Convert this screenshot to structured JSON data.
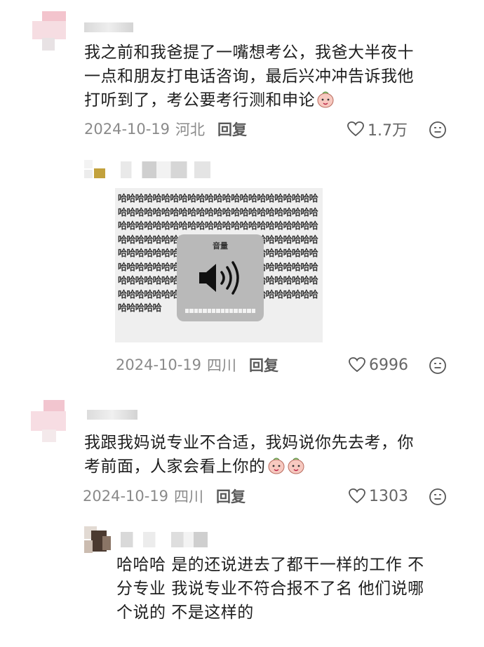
{
  "comments": [
    {
      "text": "我之前和我爸提了一嘴想考公，我爸大半夜十一点和朋友打电话咨询，最后兴冲冲告诉我他打听到了，考公要考行测和申论",
      "text_lines": [
        "我之前和我爸提了一嘴想考公，我爸大半夜十",
        "一点和朋友打电话咨询，最后兴冲冲告诉我他",
        "打听到了，考公要考行测和申论"
      ],
      "date": "2024-10-19",
      "location": "河北",
      "reply_label": "回复",
      "likes": "1.7万"
    },
    {
      "sticker": {
        "title": "音量",
        "fill_text": "哈哈哈哈哈哈哈哈哈哈哈哈哈哈哈哈哈哈哈哈哈哈哈哈哈哈哈哈哈哈哈哈哈哈哈哈哈哈哈哈哈哈哈哈哈哈哈哈哈哈哈哈哈哈哈哈哈哈哈哈哈哈哈哈哈哈哈哈哈哈哈哈哈哈哈哈哈哈哈哈哈哈哈哈哈哈哈哈哈哈哈哈哈哈哈哈哈哈哈哈哈哈哈哈哈哈哈哈哈哈哈哈哈哈哈哈哈哈哈哈哈哈哈哈哈哈哈哈哈哈哈哈哈哈哈哈哈哈哈哈哈哈哈哈哈哈哈哈哈哈哈哈哈哈哈哈哈哈哈哈哈哈哈哈哈哈哈哈哈哈哈哈哈哈哈哈哈哈哈哈哈哈哈哈哈哈哈哈哈"
      },
      "date": "2024-10-19",
      "location": "四川",
      "reply_label": "回复",
      "likes": "6996"
    },
    {
      "text": "我跟我妈说专业不合适，我妈说你先去考，你考前面，人家会看上你的",
      "text_lines": [
        "我跟我妈说专业不合适，我妈说你先去考，你",
        "考前面，人家会看上你的"
      ],
      "date": "2024-10-19",
      "location": "四川",
      "reply_label": "回复",
      "likes": "1303"
    },
    {
      "text": "哈哈哈 是的还说进去了都干一样的工作 不分专业 我说专业不符合报不了名 他们说哪个说的 不是这样的",
      "text_lines": [
        "哈哈哈 是的还说进去了都干一样的工作 不",
        "分专业 我说专业不符合报不了名 他们说哪",
        "个说的 不是这样的"
      ]
    }
  ],
  "colors": {
    "heart": "#555555",
    "meta": "#8a8a8a",
    "peach": "#f7c9c0"
  },
  "icons": [
    "heart-icon",
    "emoji-icon",
    "peach-emoji-icon",
    "speaker-icon"
  ]
}
